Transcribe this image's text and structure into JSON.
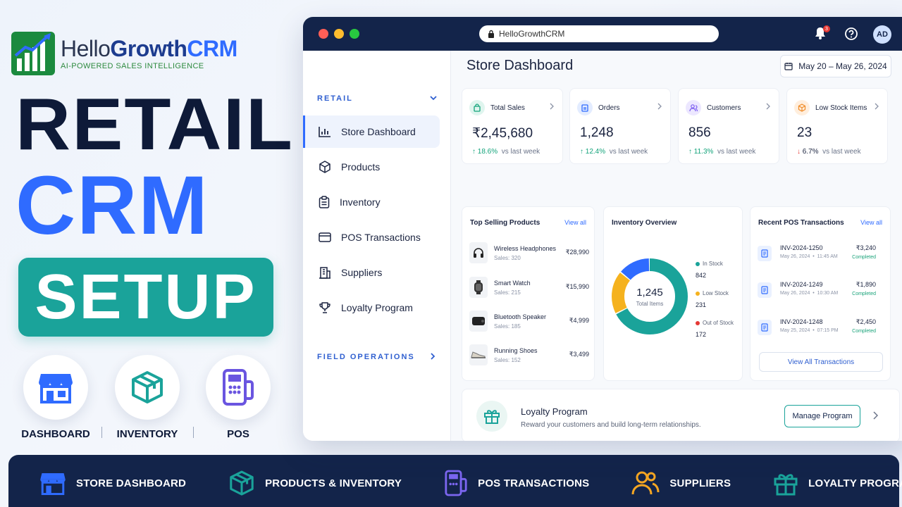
{
  "brand": {
    "name_part1": "Hello",
    "name_part2": "Growth",
    "name_part3": "CRM",
    "tagline": "AI-POWERED SALES INTELLIGENCE"
  },
  "headline": {
    "line1": "RETAIL",
    "line2": "CRM",
    "line3": "SETUP"
  },
  "features": [
    {
      "label": "DASHBOARD",
      "icon": "storefront-icon"
    },
    {
      "label": "INVENTORY",
      "icon": "box-icon"
    },
    {
      "label": "POS",
      "icon": "pos-terminal-icon"
    }
  ],
  "bottom_bar": [
    {
      "label": "STORE DASHBOARD",
      "icon": "storefront-icon"
    },
    {
      "label": "PRODUCTS & INVENTORY",
      "icon": "box-icon"
    },
    {
      "label": "POS TRANSACTIONS",
      "icon": "pos-terminal-icon"
    },
    {
      "label": "SUPPLIERS",
      "icon": "users-icon"
    },
    {
      "label": "LOYALTY PROGRAM",
      "icon": "gift-icon"
    }
  ],
  "browser": {
    "url": "HelloGrowthCRM",
    "notification_count": "3",
    "avatar_initials": "AD"
  },
  "sidebar": {
    "section1": "RETAIL",
    "items": [
      {
        "label": "Store Dashboard",
        "icon": "bar-chart-icon",
        "active": true
      },
      {
        "label": "Products",
        "icon": "cube-icon"
      },
      {
        "label": "Inventory",
        "icon": "clipboard-icon"
      },
      {
        "label": "POS Transactions",
        "icon": "credit-card-icon"
      },
      {
        "label": "Suppliers",
        "icon": "building-icon"
      },
      {
        "label": "Loyalty Program",
        "icon": "trophy-icon"
      }
    ],
    "section2": "FIELD OPERATIONS"
  },
  "main": {
    "title": "Store Dashboard",
    "date_range": "May 20 – May 26, 2024",
    "kpis": [
      {
        "label": "Total Sales",
        "value": "₹2,45,680",
        "delta": "18.6%",
        "direction": "up",
        "compare": "vs last week",
        "color": "#12a37a"
      },
      {
        "label": "Orders",
        "value": "1,248",
        "delta": "12.4%",
        "direction": "up",
        "compare": "vs last week",
        "color": "#2f6bff"
      },
      {
        "label": "Customers",
        "value": "856",
        "delta": "11.3%",
        "direction": "up",
        "compare": "vs last week",
        "color": "#7b5cf0"
      },
      {
        "label": "Low Stock Items",
        "value": "23",
        "delta": "6.7%",
        "direction": "down",
        "compare": "vs last week",
        "color": "#f08a24"
      }
    ],
    "top_products": {
      "title": "Top Selling Products",
      "link": "View all",
      "items": [
        {
          "name": "Wireless Headphones",
          "sales": "Sales: 320",
          "price": "₹28,990",
          "icon": "headphones-icon"
        },
        {
          "name": "Smart Watch",
          "sales": "Sales: 215",
          "price": "₹15,990",
          "icon": "watch-icon"
        },
        {
          "name": "Bluetooth Speaker",
          "sales": "Sales: 185",
          "price": "₹4,999",
          "icon": "speaker-icon"
        },
        {
          "name": "Running Shoes",
          "sales": "Sales: 152",
          "price": "₹3,499",
          "icon": "shoe-icon"
        }
      ]
    },
    "inventory": {
      "title": "Inventory Overview",
      "total": "1,245",
      "total_label": "Total Items",
      "segments": [
        {
          "label": "In Stock",
          "value": 842,
          "color": "#1aa39a"
        },
        {
          "label": "Low Stock",
          "value": 231,
          "color": "#f5b21e"
        },
        {
          "label": "Out of Stock",
          "value": 172,
          "color": "#2f6bff"
        }
      ]
    },
    "transactions": {
      "title": "Recent POS Transactions",
      "link": "View all",
      "items": [
        {
          "id": "INV-2024-1250",
          "date": "May 26, 2024",
          "time": "11:45 AM",
          "amount": "₹3,240",
          "status": "Completed"
        },
        {
          "id": "INV-2024-1249",
          "date": "May 26, 2024",
          "time": "10:30 AM",
          "amount": "₹1,890",
          "status": "Completed"
        },
        {
          "id": "INV-2024-1248",
          "date": "May 25, 2024",
          "time": "07:15 PM",
          "amount": "₹2,450",
          "status": "Completed"
        }
      ],
      "button": "View All Transactions"
    },
    "loyalty": {
      "title": "Loyalty Program",
      "subtitle": "Reward your customers and build long-term relationships.",
      "button": "Manage Program"
    }
  },
  "colors": {
    "navy": "#13244a",
    "accent_blue": "#2f6bff",
    "teal": "#1aa39a",
    "green": "#1b8a3e"
  }
}
